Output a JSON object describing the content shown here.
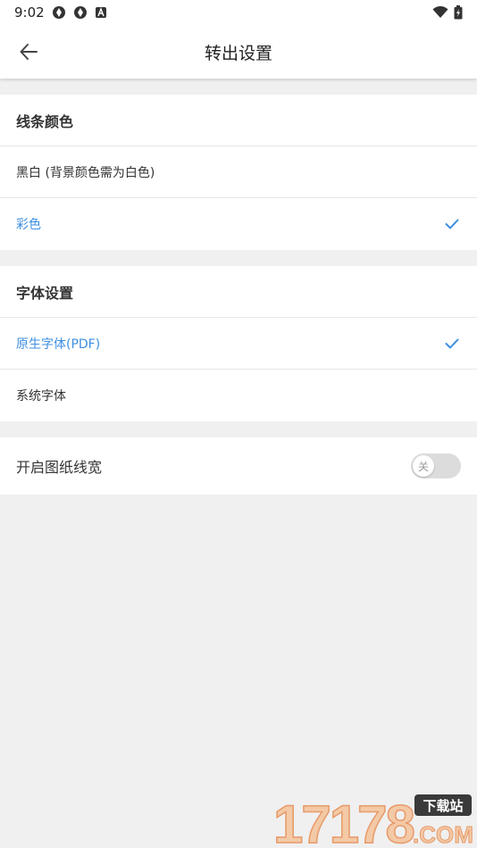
{
  "status_bar": {
    "time": "9:02",
    "icons": [
      "aperture-icon",
      "aperture-icon",
      "font-a-icon"
    ],
    "right_icons": [
      "wifi-icon",
      "battery-icon"
    ]
  },
  "app_bar": {
    "title": "转出设置",
    "back_icon": "arrow-left-icon"
  },
  "line_color": {
    "header": "线条颜色",
    "options": [
      {
        "label": "黑白 (背景颜色需为白色)",
        "selected": false
      },
      {
        "label": "彩色",
        "selected": true
      }
    ]
  },
  "font_settings": {
    "header": "字体设置",
    "options": [
      {
        "label": "原生字体(PDF)",
        "selected": true
      },
      {
        "label": "系统字体",
        "selected": false
      }
    ]
  },
  "drawing_line_width": {
    "label": "开启图纸线宽",
    "toggle_text": "关",
    "enabled": false
  },
  "colors": {
    "accent": "#3d8fe0",
    "background": "#f0f0f0"
  },
  "watermark": {
    "text_number": "17178",
    "text_cn": "下载站",
    "text_com": ".COM"
  }
}
